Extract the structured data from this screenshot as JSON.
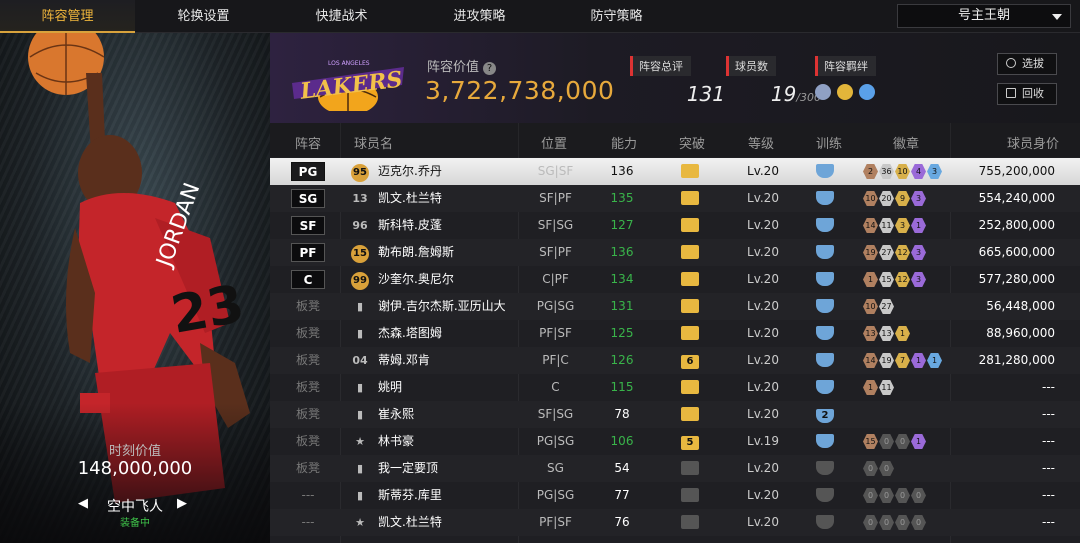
{
  "tabs": [
    "阵容管理",
    "轮换设置",
    "快捷战术",
    "进攻策略",
    "防守策略"
  ],
  "team_selector": "号主王朝",
  "left_panel": {
    "moment_value_label": "时刻价值",
    "moment_value": "148,000,000",
    "card_name": "空中飞人",
    "equipped": "装备中"
  },
  "header": {
    "team_value_label": "阵容价值",
    "team_value": "3,722,738,000",
    "total_rating_label": "阵容总评",
    "total_rating": "131",
    "players_label": "球员数",
    "players": "19",
    "players_max": "/300",
    "bonds_label": "阵容羁绊",
    "select_button": "选拔",
    "recycle_button": "回收"
  },
  "columns": [
    "阵容",
    "球员名",
    "位置",
    "能力",
    "突破",
    "等级",
    "训练",
    "徽章",
    "球员身价"
  ],
  "rows": [
    {
      "slot": "PG",
      "name": "迈克尔.乔丹",
      "pos": "SG|SF",
      "ovr": "136",
      "brk": "",
      "lvl": "Lv.20",
      "train": "",
      "badges": [
        "2",
        "36",
        "10",
        "4",
        "3"
      ],
      "value": "755,200,000",
      "icon": "95",
      "sel": true
    },
    {
      "slot": "SG",
      "name": "凯文.杜兰特",
      "pos": "SF|PF",
      "ovr": "135",
      "brk": "",
      "lvl": "Lv.20",
      "train": "",
      "badges": [
        "10",
        "20",
        "9",
        "3"
      ],
      "value": "554,240,000",
      "icon": "13"
    },
    {
      "slot": "SF",
      "name": "斯科特.皮蓬",
      "pos": "SF|SG",
      "ovr": "127",
      "brk": "",
      "lvl": "Lv.20",
      "train": "",
      "badges": [
        "14",
        "11",
        "3",
        "1"
      ],
      "value": "252,800,000",
      "icon": "96"
    },
    {
      "slot": "PF",
      "name": "勒布朗.詹姆斯",
      "pos": "SF|PF",
      "ovr": "136",
      "brk": "",
      "lvl": "Lv.20",
      "train": "",
      "badges": [
        "19",
        "27",
        "12",
        "3"
      ],
      "value": "665,600,000",
      "icon": "15"
    },
    {
      "slot": "C",
      "name": "沙奎尔.奥尼尔",
      "pos": "C|PF",
      "ovr": "134",
      "brk": "",
      "lvl": "Lv.20",
      "train": "",
      "badges": [
        "1",
        "15",
        "12",
        "3"
      ],
      "value": "577,280,000",
      "icon": "99"
    },
    {
      "slot": "板凳",
      "name": "谢伊.吉尔杰斯.亚历山大",
      "pos": "PG|SG",
      "ovr": "131",
      "brk": "",
      "lvl": "Lv.20",
      "train": "",
      "badges": [
        "10",
        "27"
      ],
      "value": "56,448,000",
      "icon": ""
    },
    {
      "slot": "板凳",
      "name": "杰森.塔图姆",
      "pos": "PF|SF",
      "ovr": "125",
      "brk": "",
      "lvl": "Lv.20",
      "train": "",
      "badges": [
        "13",
        "13",
        "1"
      ],
      "value": "88,960,000",
      "icon": ""
    },
    {
      "slot": "板凳",
      "name": "蒂姆.邓肯",
      "pos": "PF|C",
      "ovr": "126",
      "brk": "6",
      "lvl": "Lv.20",
      "train": "",
      "badges": [
        "14",
        "19",
        "7",
        "1",
        "1"
      ],
      "value": "281,280,000",
      "icon": "04"
    },
    {
      "slot": "板凳",
      "name": "姚明",
      "pos": "C",
      "ovr": "115",
      "brk": "",
      "lvl": "Lv.20",
      "train": "",
      "badges": [
        "1",
        "11"
      ],
      "value": "---",
      "icon": ""
    },
    {
      "slot": "板凳",
      "name": "崔永熙",
      "pos": "SF|SG",
      "ovr": "78",
      "brk": "",
      "lvl": "Lv.20",
      "train": "2",
      "badges": [],
      "value": "---",
      "icon": ""
    },
    {
      "slot": "板凳",
      "name": "林书豪",
      "pos": "PG|SG",
      "ovr": "106",
      "brk": "5",
      "lvl": "Lv.19",
      "train": "",
      "badges": [
        "15",
        "0",
        "0",
        "1"
      ],
      "value": "---",
      "icon": ""
    },
    {
      "slot": "板凳",
      "name": "我一定要顶",
      "pos": "SG",
      "ovr": "54",
      "brk": "",
      "lvl": "Lv.20",
      "train": "",
      "badges": [
        "0",
        "0"
      ],
      "value": "---",
      "icon": ""
    },
    {
      "slot": "---",
      "name": "斯蒂芬.库里",
      "pos": "PG|SG",
      "ovr": "77",
      "brk": "",
      "lvl": "Lv.20",
      "train": "",
      "badges": [
        "0",
        "0",
        "0",
        "0"
      ],
      "value": "---",
      "icon": ""
    },
    {
      "slot": "---",
      "name": "凯文.杜兰特",
      "pos": "PF|SF",
      "ovr": "76",
      "brk": "",
      "lvl": "Lv.20",
      "train": "",
      "badges": [
        "0",
        "0",
        "0",
        "0"
      ],
      "value": "---",
      "icon": ""
    }
  ]
}
